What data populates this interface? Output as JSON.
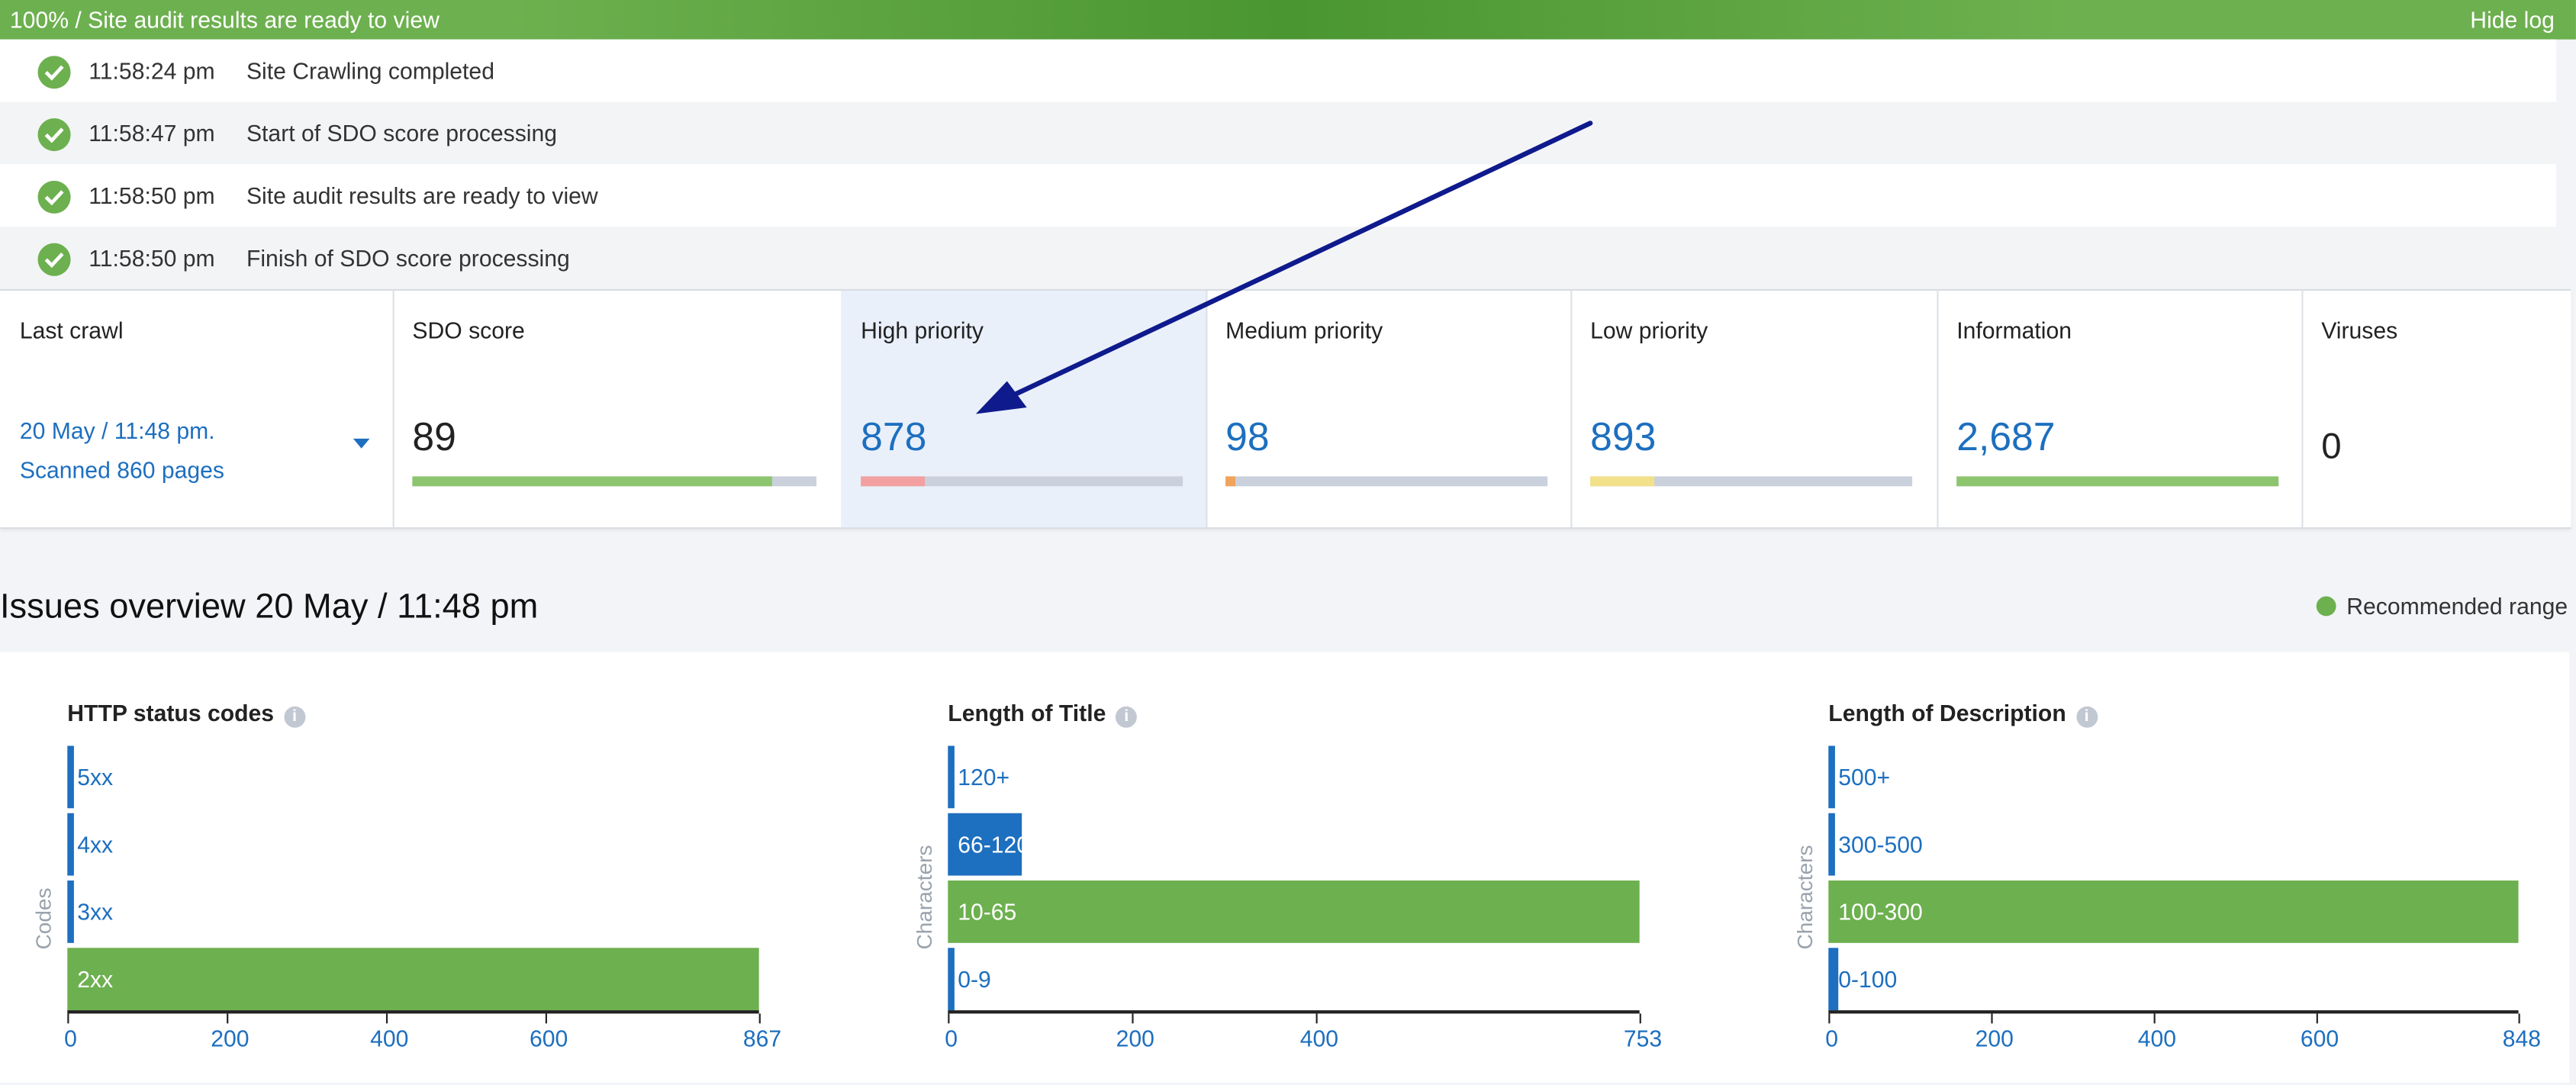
{
  "progress": {
    "text": "100% / Site audit results are ready to view",
    "hide_label": "Hide log"
  },
  "log": [
    {
      "time": "11:58:24 pm",
      "message": "Site Crawling completed"
    },
    {
      "time": "11:58:47 pm",
      "message": "Start of SDO score processing"
    },
    {
      "time": "11:58:50 pm",
      "message": "Site audit results are ready to view"
    },
    {
      "time": "11:58:50 pm",
      "message": "Finish of SDO score processing"
    }
  ],
  "stats": {
    "last_crawl": {
      "label": "Last crawl",
      "date": "20 May / 11:48 pm.",
      "scanned": "Scanned 860 pages"
    },
    "sdo": {
      "label": "SDO score",
      "value": "89",
      "fill": 0.89
    },
    "high": {
      "label": "High priority",
      "value": "878",
      "fill": 0.2
    },
    "medium": {
      "label": "Medium priority",
      "value": "98",
      "fill": 0.03
    },
    "low": {
      "label": "Low priority",
      "value": "893",
      "fill": 0.2
    },
    "info": {
      "label": "Information",
      "value": "2,687",
      "fill": 1.0
    },
    "viruses": {
      "label": "Viruses",
      "value": "0"
    }
  },
  "colors": {
    "green": "#6db04f",
    "blue": "#1d6fbf",
    "red": "#f2a0a0",
    "orange": "#f0a35a",
    "yellow": "#f3e08a",
    "track": "#cbd1dc",
    "arrow": "#0f1a8c"
  },
  "overview": {
    "title": "Issues overview 20 May / 11:48 pm",
    "legend": "Recommended range"
  },
  "chart_data": [
    {
      "type": "bar",
      "title": "HTTP status codes",
      "ylabel": "Codes",
      "categories": [
        "5xx",
        "4xx",
        "3xx",
        "2xx"
      ],
      "values": [
        0,
        0,
        0,
        867
      ],
      "highlight": [
        "2xx"
      ],
      "xlim": [
        0,
        867
      ],
      "xticks": [
        "0",
        "200",
        "400",
        "600",
        "867"
      ]
    },
    {
      "type": "bar",
      "title": "Length of Title",
      "ylabel": "Characters",
      "categories": [
        "120+",
        "66-120",
        "10-65",
        "0-9"
      ],
      "values": [
        0,
        80,
        753,
        0
      ],
      "highlight": [
        "10-65"
      ],
      "xlim": [
        0,
        753
      ],
      "xticks": [
        "0",
        "200",
        "400",
        "753"
      ]
    },
    {
      "type": "bar",
      "title": "Length of Description",
      "ylabel": "Characters",
      "categories": [
        "500+",
        "300-500",
        "100-300",
        "0-100"
      ],
      "values": [
        0,
        0,
        848,
        12
      ],
      "highlight": [
        "100-300"
      ],
      "xlim": [
        0,
        848
      ],
      "xticks": [
        "0",
        "200",
        "400",
        "600",
        "848"
      ]
    }
  ]
}
